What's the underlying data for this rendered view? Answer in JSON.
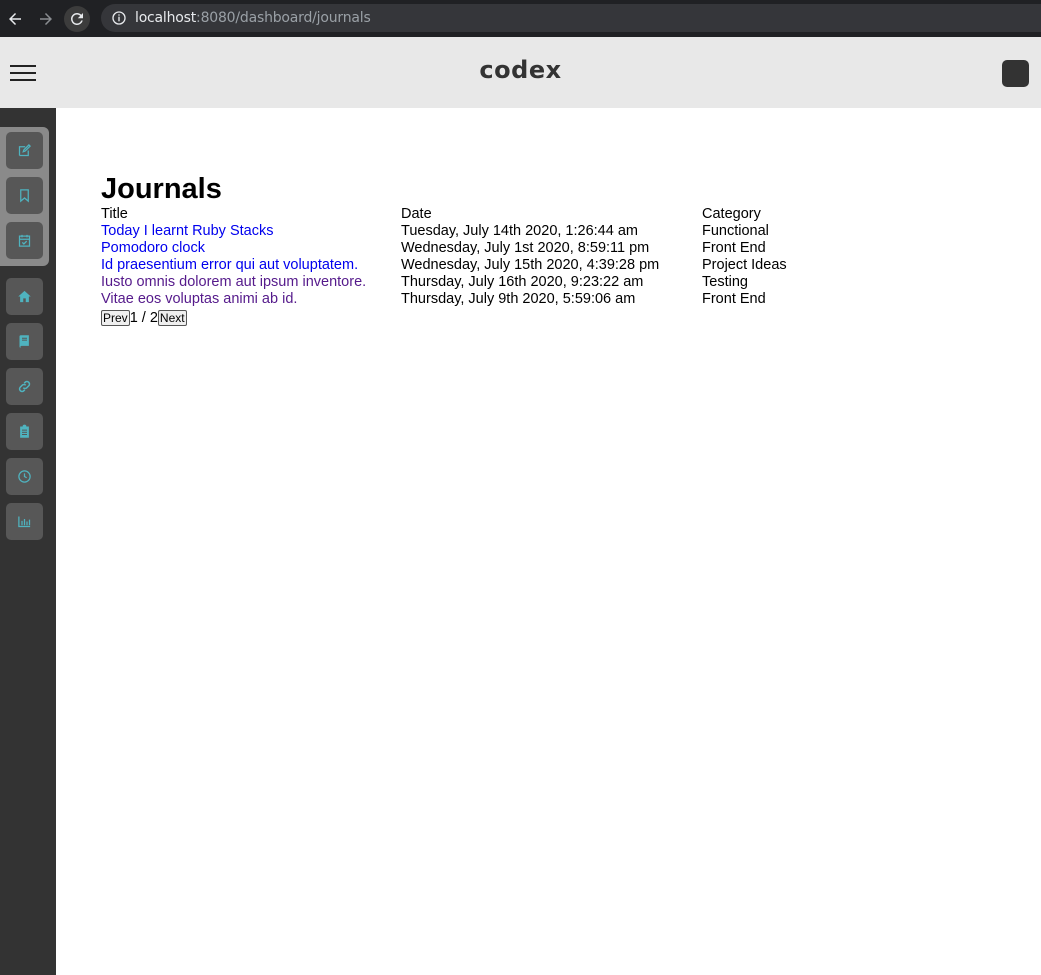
{
  "browser": {
    "url_host": "localhost",
    "url_path": ":8080/dashboard/journals"
  },
  "header": {
    "brand": "codex"
  },
  "sidebar": {
    "group_items": [
      {
        "icon": "edit-icon"
      },
      {
        "icon": "bookmark-icon"
      },
      {
        "icon": "calendar-check-icon"
      }
    ],
    "items": [
      {
        "icon": "home-icon"
      },
      {
        "icon": "book-icon"
      },
      {
        "icon": "link-icon"
      },
      {
        "icon": "clipboard-icon"
      },
      {
        "icon": "clock-icon"
      },
      {
        "icon": "bar-chart-icon"
      }
    ],
    "icon_color": "#4fb3bf"
  },
  "main": {
    "title": "Journals",
    "columns": [
      "Title",
      "Date",
      "Category"
    ],
    "rows": [
      {
        "title": "Today I learnt Ruby Stacks",
        "date": "Tuesday, July 14th 2020, 1:26:44 am",
        "category": "Functional"
      },
      {
        "title": "Pomodoro clock",
        "date": "Wednesday, July 1st 2020, 8:59:11 pm",
        "category": "Front End"
      },
      {
        "title": "Id praesentium error qui aut voluptatem.",
        "date": "Wednesday, July 15th 2020, 4:39:28 pm",
        "category": "Project Ideas"
      },
      {
        "title": "Iusto omnis dolorem aut ipsum inventore.",
        "date": "Thursday, July 16th 2020, 9:23:22 am",
        "category": "Testing"
      },
      {
        "title": "Vitae eos voluptas animi ab id.",
        "date": "Thursday, July 9th 2020, 5:59:06 am",
        "category": "Front End"
      }
    ],
    "pagination": {
      "prev_label": "Prev",
      "page_info": "1 / 2",
      "next_label": "Next"
    }
  }
}
